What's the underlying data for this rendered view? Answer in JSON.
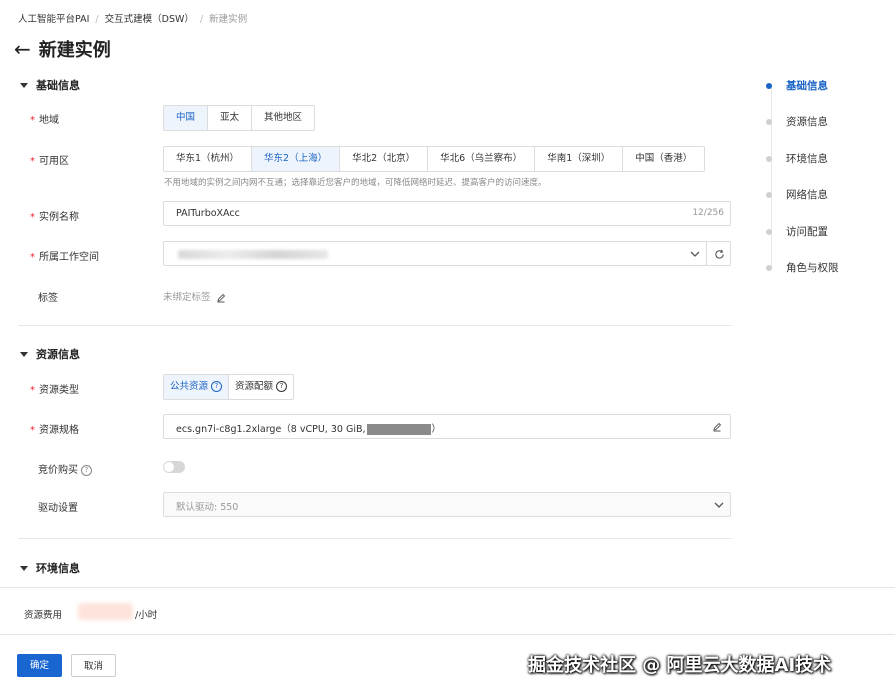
{
  "breadcrumb": {
    "items": [
      "人工智能平台PAI",
      "交互式建模（DSW）"
    ],
    "current": "新建实例"
  },
  "page": {
    "title": "新建实例"
  },
  "sections": {
    "basic": "基础信息",
    "resource": "资源信息",
    "env": "环境信息"
  },
  "basic": {
    "region_label": "地域",
    "region_options": [
      "中国",
      "亚太",
      "其他地区"
    ],
    "region_selected": "中国",
    "zone_label": "可用区",
    "zone_options": [
      "华东1（杭州）",
      "华东2（上海）",
      "华北2（北京）",
      "华北6（乌兰察布）",
      "华南1（深圳）",
      "中国（香港）"
    ],
    "zone_selected": "华东2（上海）",
    "zone_hint": "不用地域的实例之间内网不互通；选择靠近您客户的地域，可降低网络时延迟、提高客户的访问速度。",
    "name_label": "实例名称",
    "name_value": "PAITurboXAcc",
    "name_counter": "12/256",
    "workspace_label": "所属工作空间",
    "tag_label": "标签",
    "tag_value": "未绑定标签"
  },
  "resource": {
    "type_label": "资源类型",
    "type_options": [
      "公共资源",
      "资源配额"
    ],
    "spec_label": "资源规格",
    "spec_value": "ecs.gn7i-c8g1.2xlarge（8 vCPU, 30 GiB,",
    "spec_suffix": "）",
    "bid_label": "竞价购买",
    "driver_label": "驱动设置",
    "driver_value": "默认驱动: 550"
  },
  "toc": {
    "items": [
      "基础信息",
      "资源信息",
      "环境信息",
      "网络信息",
      "访问配置",
      "角色与权限"
    ],
    "active": "基础信息"
  },
  "footer": {
    "cost_label": "资源费用",
    "cost_unit": "/小时",
    "confirm": "确定",
    "cancel": "取消"
  },
  "watermark": "掘金技术社区 @ 阿里云大数据AI技术",
  "colors": {
    "accent": "#1a63c6",
    "primary_button": "#1a66d0",
    "required": "#e23"
  }
}
